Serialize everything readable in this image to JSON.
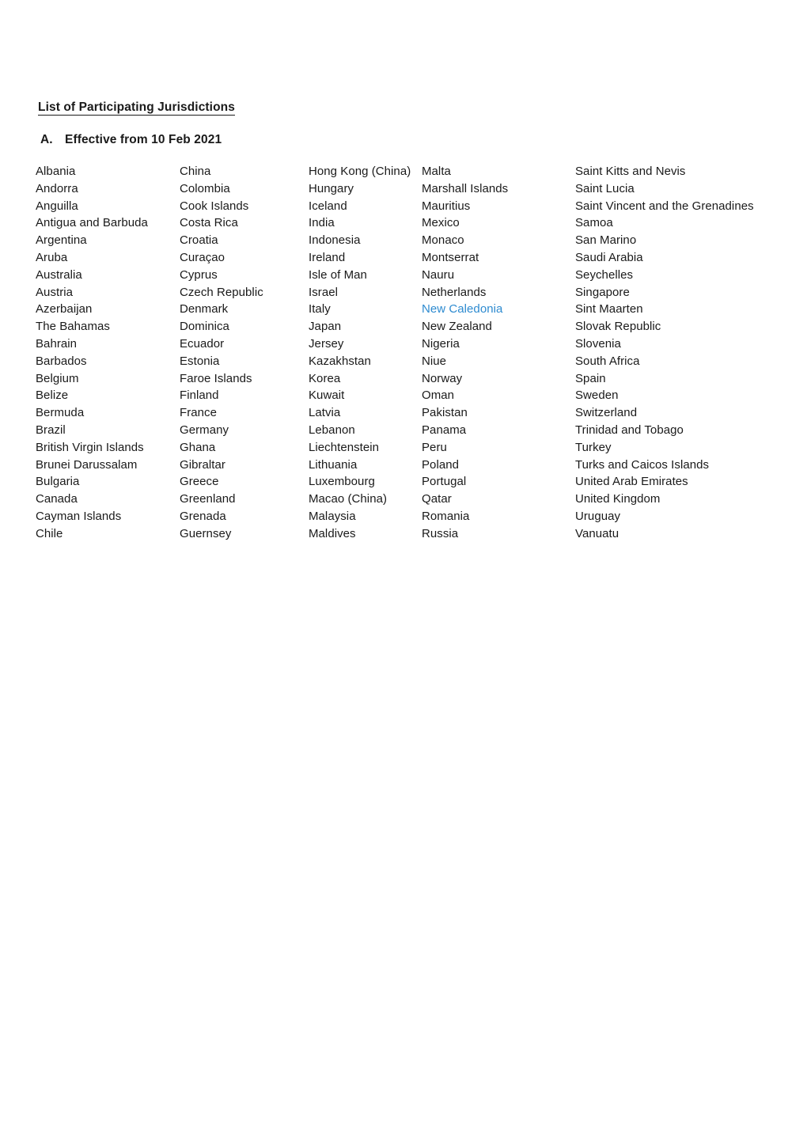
{
  "document": {
    "title": "List of Participating Jurisdictions",
    "section": {
      "marker": "A.",
      "heading": "Effective from 10 Feb 2021"
    },
    "highlight_color": "#2E8BD0",
    "text_color": "#1a1a1a",
    "background_color": "#ffffff"
  },
  "jurisdictions": {
    "column_count": 5,
    "row_count": 22,
    "rows": [
      [
        "Albania",
        "China",
        "Hong Kong (China)",
        "Malta",
        "Saint Kitts and Nevis"
      ],
      [
        "Andorra",
        "Colombia",
        "Hungary",
        "Marshall Islands",
        "Saint Lucia"
      ],
      [
        "Anguilla",
        "Cook Islands",
        "Iceland",
        "Mauritius",
        "Saint Vincent and the Grenadines"
      ],
      [
        "Antigua and Barbuda",
        "Costa Rica",
        "India",
        "Mexico",
        "Samoa"
      ],
      [
        "Argentina",
        "Croatia",
        "Indonesia",
        "Monaco",
        "San Marino"
      ],
      [
        "Aruba",
        "Curaçao",
        "Ireland",
        "Montserrat",
        "Saudi Arabia"
      ],
      [
        "Australia",
        "Cyprus",
        "Isle of Man",
        "Nauru",
        "Seychelles"
      ],
      [
        "Austria",
        "Czech Republic",
        "Israel",
        "Netherlands",
        "Singapore"
      ],
      [
        "Azerbaijan",
        "Denmark",
        "Italy",
        "New Caledonia",
        "Sint Maarten"
      ],
      [
        "The Bahamas",
        "Dominica",
        "Japan",
        "New Zealand",
        "Slovak Republic"
      ],
      [
        "Bahrain",
        "Ecuador",
        "Jersey",
        "Nigeria",
        "Slovenia"
      ],
      [
        "Barbados",
        "Estonia",
        "Kazakhstan",
        "Niue",
        "South Africa"
      ],
      [
        "Belgium",
        "Faroe Islands",
        "Korea",
        "Norway",
        "Spain"
      ],
      [
        "Belize",
        "Finland",
        "Kuwait",
        "Oman",
        "Sweden"
      ],
      [
        "Bermuda",
        "France",
        "Latvia",
        "Pakistan",
        "Switzerland"
      ],
      [
        "Brazil",
        "Germany",
        "Lebanon",
        "Panama",
        "Trinidad and Tobago"
      ],
      [
        "British Virgin Islands",
        "Ghana",
        "Liechtenstein",
        "Peru",
        "Turkey"
      ],
      [
        "Brunei Darussalam",
        "Gibraltar",
        "Lithuania",
        "Poland",
        "Turks and Caicos Islands"
      ],
      [
        "Bulgaria",
        "Greece",
        "Luxembourg",
        "Portugal",
        "United Arab Emirates"
      ],
      [
        "Canada",
        "Greenland",
        "Macao (China)",
        "Qatar",
        "United Kingdom"
      ],
      [
        "Cayman Islands",
        "Grenada",
        "Malaysia",
        "Romania",
        "Uruguay"
      ],
      [
        "Chile",
        "Guernsey",
        "Maldives",
        "Russia",
        "Vanuatu"
      ]
    ],
    "highlighted": [
      {
        "row": 8,
        "col": 3,
        "value": "New Caledonia"
      }
    ]
  }
}
